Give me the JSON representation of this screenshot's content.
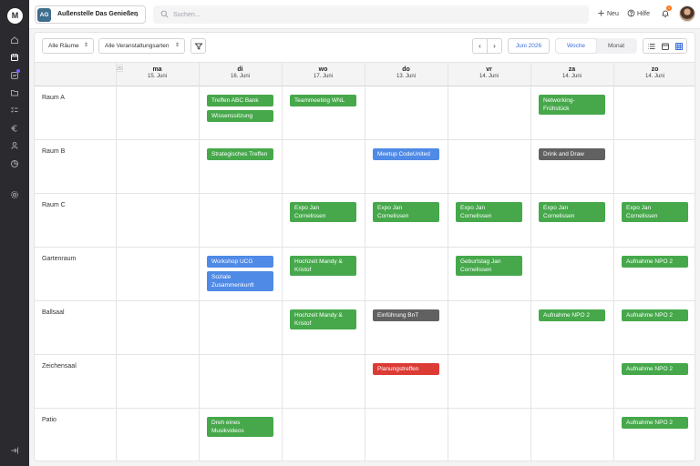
{
  "app": {
    "logo_letter": "M",
    "workspace": {
      "initials": "AG",
      "name": "Außenstelle Das Genießen"
    },
    "search": {
      "placeholder": "Suchen..."
    },
    "actions": {
      "new_label": "Neu",
      "help_label": "Hilfe",
      "notification_count": "3"
    },
    "sidebar_icons": [
      "home-icon",
      "calendar-icon",
      "activity-icon",
      "folder-icon",
      "tasks-icon",
      "euro-icon",
      "users-icon",
      "chart-icon",
      "settings-icon",
      "logout-icon"
    ]
  },
  "toolbar": {
    "rooms_filter": "Alle Räume",
    "types_filter": "Alle Veranstaltungsarten",
    "prev_label": "‹",
    "next_label": "›",
    "current_month": "Juni 2026",
    "view_week": "Woche",
    "view_month": "Monat"
  },
  "calendar": {
    "week_number": "25",
    "days": [
      {
        "name": "ma",
        "date": "15. Juni"
      },
      {
        "name": "di",
        "date": "16. Juni"
      },
      {
        "name": "wo",
        "date": "17. Juni"
      },
      {
        "name": "do",
        "date": "13. Juni"
      },
      {
        "name": "vr",
        "date": "14. Juni"
      },
      {
        "name": "za",
        "date": "14. Juni"
      },
      {
        "name": "zo",
        "date": "14. Juni"
      }
    ],
    "rooms": [
      {
        "name": "Raum A",
        "events": [
          {
            "day": 1,
            "stack": 0,
            "label": "Treffen ABC Bank",
            "color": "green"
          },
          {
            "day": 1,
            "stack": 1,
            "label": "Wissenssitzung",
            "color": "green"
          },
          {
            "day": 2,
            "stack": 0,
            "label": "Teammeeting WNL",
            "color": "green"
          },
          {
            "day": 5,
            "stack": 0,
            "label": "Networking-Frühstück",
            "color": "green"
          }
        ]
      },
      {
        "name": "Raum B",
        "events": [
          {
            "day": 1,
            "stack": 0,
            "label": "Strategisches Treffen",
            "color": "green"
          },
          {
            "day": 3,
            "stack": 0,
            "label": "Meetup CodeUnited",
            "color": "blue"
          },
          {
            "day": 5,
            "stack": 0,
            "label": "Drink and Draw",
            "color": "gray"
          }
        ]
      },
      {
        "name": "Raum C",
        "events": [
          {
            "day": 2,
            "stack": 0,
            "label": "Expo Jan Cornelissen",
            "color": "green"
          },
          {
            "day": 3,
            "stack": 0,
            "label": "Expo Jan Cornelissen",
            "color": "green"
          },
          {
            "day": 4,
            "stack": 0,
            "label": "Expo Jan Cornelissen",
            "color": "green"
          },
          {
            "day": 5,
            "stack": 0,
            "label": "Expo Jan Cornelissen",
            "color": "green"
          },
          {
            "day": 6,
            "stack": 0,
            "label": "Expo Jan Cornelissen",
            "color": "green"
          }
        ]
      },
      {
        "name": "Gartenraum",
        "events": [
          {
            "day": 1,
            "stack": 0,
            "label": "Workshop UCG",
            "color": "blue"
          },
          {
            "day": 1,
            "stack": 1,
            "label": "Soziale Zusammenkunft",
            "color": "blue"
          },
          {
            "day": 2,
            "stack": 0,
            "label": "Hochzeit Mandy & Kristof",
            "color": "green"
          },
          {
            "day": 4,
            "stack": 0,
            "label": "Geburtstag Jan Cornelissen",
            "color": "green"
          },
          {
            "day": 6,
            "stack": 0,
            "label": "Aufnahme NPO 2",
            "color": "green"
          }
        ]
      },
      {
        "name": "Ballsaal",
        "events": [
          {
            "day": 2,
            "stack": 0,
            "label": "Hochzeit Mandy & Kristof",
            "color": "green"
          },
          {
            "day": 3,
            "stack": 0,
            "label": "Einführung BnT",
            "color": "gray"
          },
          {
            "day": 5,
            "stack": 0,
            "label": "Aufnahme NPO 2",
            "color": "green"
          },
          {
            "day": 6,
            "stack": 0,
            "label": "Aufnahme NPO 2",
            "color": "green"
          }
        ]
      },
      {
        "name": "Zeichensaal",
        "events": [
          {
            "day": 3,
            "stack": 0,
            "label": "Planungstreffen",
            "color": "red"
          },
          {
            "day": 6,
            "stack": 0,
            "label": "Aufnahme NPO 2",
            "color": "green"
          }
        ]
      },
      {
        "name": "Patio",
        "events": [
          {
            "day": 1,
            "stack": 0,
            "label": "Dreh eines Musikvideos",
            "color": "green"
          },
          {
            "day": 6,
            "stack": 0,
            "label": "Aufnahme NPO 2",
            "color": "green"
          }
        ]
      }
    ]
  }
}
